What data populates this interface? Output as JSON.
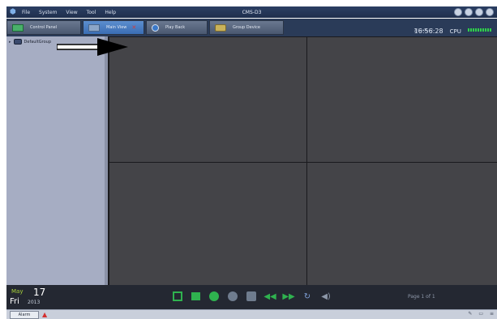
{
  "window": {
    "title": "CMS-D3"
  },
  "menu": [
    "File",
    "System",
    "View",
    "Tool",
    "Help"
  ],
  "tabs": [
    {
      "label": "Control Panel",
      "icon": "monitor-icon"
    },
    {
      "label": "Main View",
      "icon": "screen-icon",
      "active": true
    },
    {
      "label": "Play Back",
      "icon": "playback-icon"
    },
    {
      "label": "Group Device",
      "icon": "group-device-icon"
    }
  ],
  "status": {
    "time": "16:56:28",
    "date": "2013-05-17",
    "cpu_label": "CPU"
  },
  "sidebar": {
    "tree": [
      {
        "label": "DefaultGroup",
        "icon": "camera-group-icon"
      }
    ]
  },
  "video_grid": {
    "rows": 2,
    "cols": 2
  },
  "datebox": {
    "month": "May",
    "day": "17",
    "weekday": "Fri",
    "year": "2013"
  },
  "toolbar": {
    "controls": [
      "fit-screen-icon",
      "stop-icon",
      "record-icon",
      "film-icon",
      "camera-icon",
      "rewind-icon",
      "fast-forward-icon",
      "loop-icon",
      "volume-icon"
    ],
    "page_info": "Page 1 of 1"
  },
  "statusbar": {
    "alarm_label": "Alarm"
  },
  "colors": {
    "accent_green": "#2fb24f",
    "tab_active": "#3a6db3",
    "grid_bg": "#444448"
  }
}
